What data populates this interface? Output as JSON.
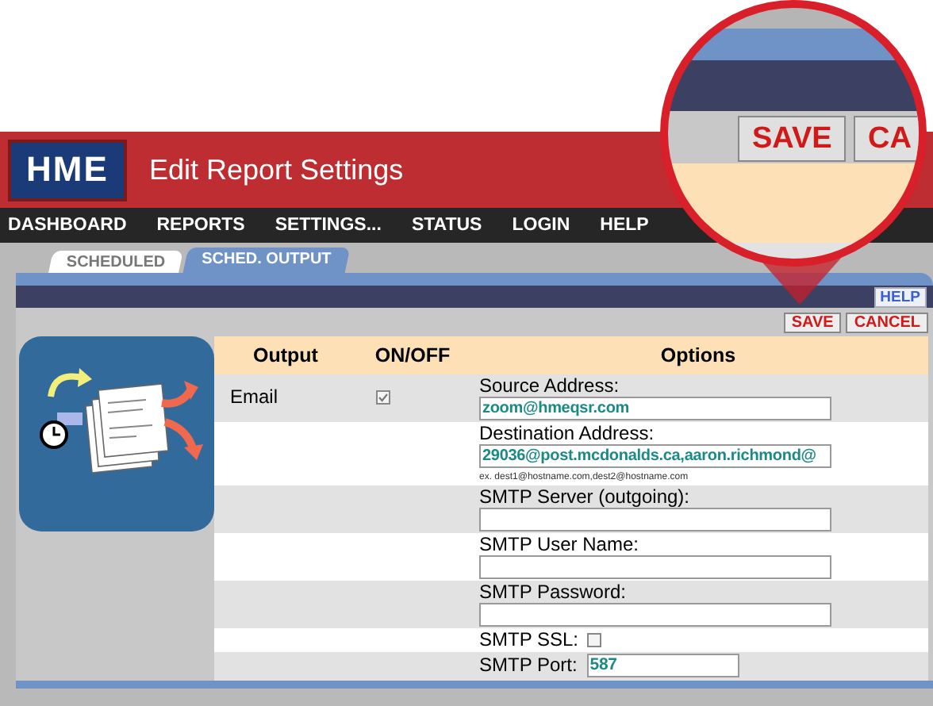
{
  "header": {
    "logo": "HME",
    "title": "Edit Report Settings"
  },
  "nav": [
    {
      "label": "DASHBOARD"
    },
    {
      "label": "REPORTS"
    },
    {
      "label": "SETTINGS..."
    },
    {
      "label": "STATUS"
    },
    {
      "label": "LOGIN"
    },
    {
      "label": "HELP"
    }
  ],
  "tabs": [
    {
      "label": "SCHEDULED",
      "selected": false
    },
    {
      "label": "SCHED. OUTPUT",
      "selected": true
    }
  ],
  "help_button": "HELP",
  "actions": [
    "SAVE",
    "CANCEL"
  ],
  "table": {
    "columns": [
      "Output",
      "ON/OFF",
      "Options"
    ],
    "output": {
      "label": "Email",
      "on": true
    },
    "options": [
      {
        "kind": "field",
        "label": "Source Address:",
        "value": "zoom@hmeqsr.com"
      },
      {
        "kind": "field",
        "label": "Destination Address:",
        "value": "29036@post.mcdonalds.ca,aaron.richmond@",
        "hint": "ex. dest1@hostname.com,dest2@hostname.com"
      },
      {
        "kind": "field",
        "label": "SMTP Server (outgoing):"
      },
      {
        "kind": "field",
        "label": "SMTP User Name:"
      },
      {
        "kind": "field",
        "label": "SMTP Password:"
      },
      {
        "kind": "checkbox",
        "label": "SMTP SSL:",
        "checked": false
      },
      {
        "kind": "inline-field",
        "label": "SMTP Port:",
        "value": "587"
      }
    ]
  },
  "magnifier": {
    "buttons": [
      "SAVE",
      "CA"
    ]
  }
}
